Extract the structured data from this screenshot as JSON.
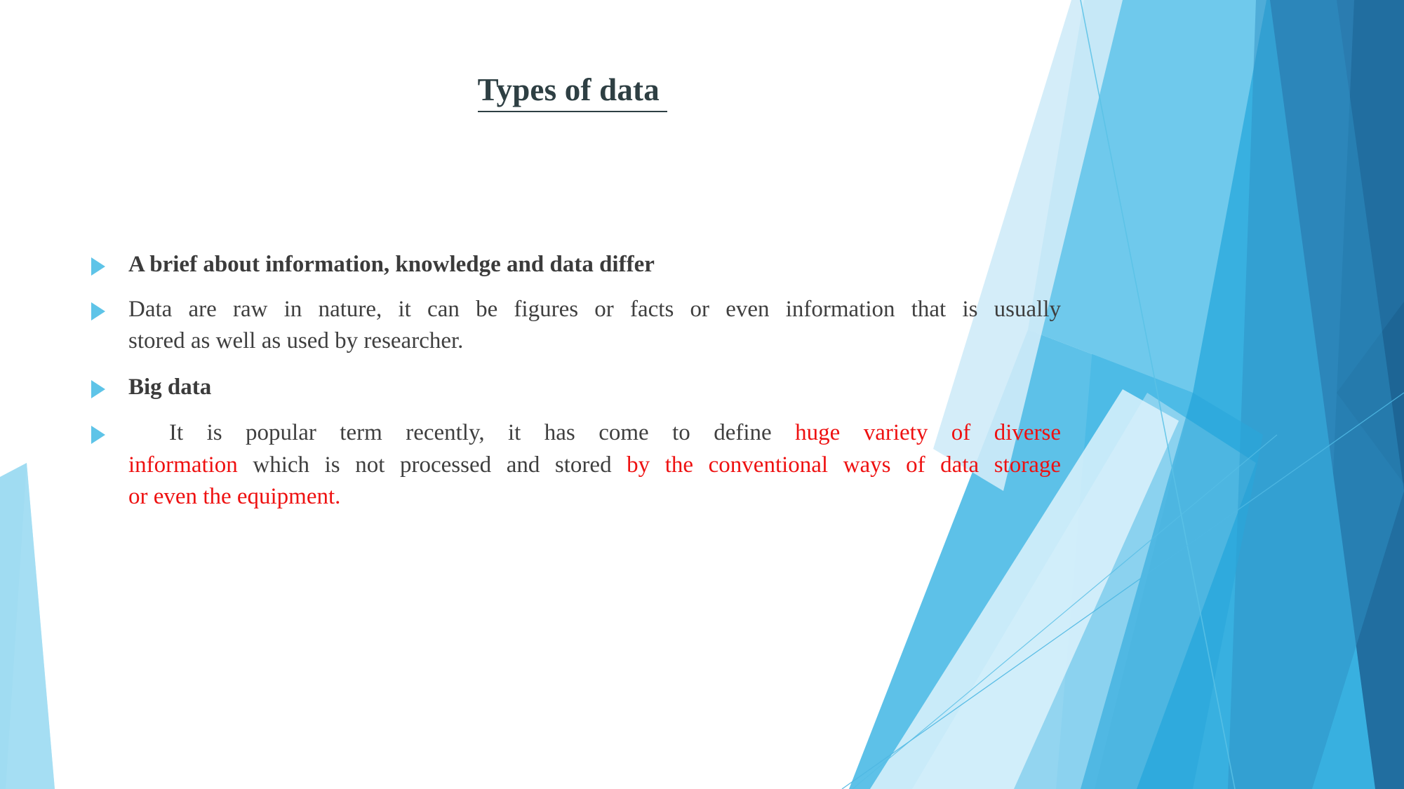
{
  "slide": {
    "title": "Types of data ",
    "background_theme": "facet-blue-angled-bands",
    "colors": {
      "title": "#2e3f43",
      "body_text": "#3f3f3f",
      "highlight_red": "#ee1111",
      "bullet_marker": "#5EC4E8",
      "accent_light_blue": "#6FC9EC",
      "accent_pale_blue": "#BFE6F6",
      "accent_mid_blue": "#31A9DC",
      "accent_deep_blue": "#2C7FB3",
      "accent_dark_blue": "#1F6A9B",
      "page_background": "#ffffff"
    }
  },
  "bullets": [
    {
      "id": "bullet-brief",
      "marker": "triangle-right-icon",
      "bold": true,
      "runs": [
        {
          "text": "A brief about information, knowledge and data differ",
          "color": "body"
        }
      ]
    },
    {
      "id": "bullet-data-definition",
      "marker": "triangle-right-icon",
      "bold": false,
      "runs": [
        {
          "text": "Data are raw in nature, it can be figures or facts or even information that is usually stored as well as used by researcher.",
          "color": "body"
        }
      ]
    },
    {
      "id": "bullet-big-data",
      "marker": "triangle-right-icon",
      "bold": true,
      "runs": [
        {
          "text": "Big data",
          "color": "body"
        }
      ]
    },
    {
      "id": "bullet-big-data-definition",
      "marker": "triangle-right-icon",
      "bold": false,
      "runs": [
        {
          "text": "It is popular term recently, it has come to define ",
          "color": "body"
        },
        {
          "text": "huge variety of diverse information",
          "color": "red"
        },
        {
          "text": " which is not processed and stored ",
          "color": "body"
        },
        {
          "text": "by the conventional ways of data storage or even the equipment.",
          "color": "red"
        }
      ]
    }
  ],
  "bullet_text_lines": {
    "b1_line1": "A brief about information, knowledge and data differ",
    "b2_line1": "Data are raw in nature, it can be figures or facts or even information that is usually",
    "b2_line2": "stored as well as used by researcher.",
    "b3_line1": "Big data",
    "b4_line1_plain": "It is popular term recently, it has come to define",
    "b4_line1_red": "huge variety of diverse",
    "b4_line2_red_a": "information",
    "b4_line2_plain": "which is not processed and stored",
    "b4_line2_red_b": "by the conventional ways of data storage",
    "b4_line3_red": "or even the equipment."
  }
}
